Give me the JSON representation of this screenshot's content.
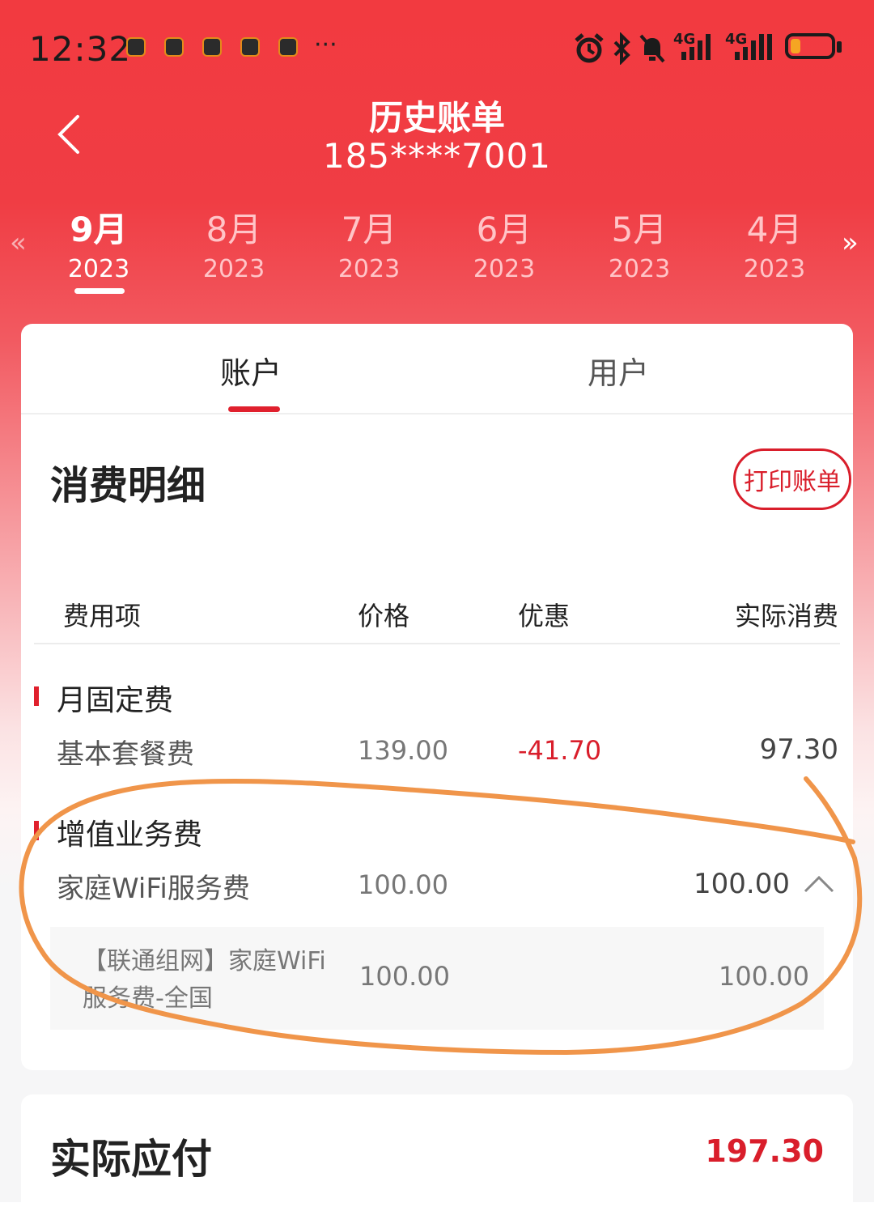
{
  "status_bar": {
    "time": "12:32",
    "more": "···",
    "network_1": "4G",
    "network_2": "4G"
  },
  "header": {
    "title": "历史账单",
    "phone": "185****7001"
  },
  "months": [
    {
      "month": "9月",
      "year": "2023",
      "active": true
    },
    {
      "month": "8月",
      "year": "2023"
    },
    {
      "month": "7月",
      "year": "2023"
    },
    {
      "month": "6月",
      "year": "2023"
    },
    {
      "month": "5月",
      "year": "2023"
    },
    {
      "month": "4月",
      "year": "2023"
    }
  ],
  "nav_arrows": {
    "prev": "«",
    "next": "»"
  },
  "tabs": {
    "account": "账户",
    "user": "用户"
  },
  "detail": {
    "title": "消费明细",
    "print_button": "打印账单",
    "columns": [
      "费用项",
      "价格",
      "优惠",
      "实际消费"
    ],
    "groups": [
      {
        "name": "月固定费",
        "items": [
          {
            "name": "基本套餐费",
            "price": "139.00",
            "discount": "-41.70",
            "actual": "97.30"
          }
        ]
      },
      {
        "name": "增值业务费",
        "items": [
          {
            "name": "家庭WiFi服务费",
            "price": "100.00",
            "discount": "",
            "actual": "100.00"
          }
        ],
        "sub_items": [
          {
            "name": "【联通组网】家庭WiFi服务费-全国",
            "price": "100.00",
            "actual": "100.00"
          }
        ]
      }
    ]
  },
  "total": {
    "label": "实际应付",
    "value": "197.30"
  },
  "colors": {
    "brand_red": "#e0202d",
    "annotation_orange": "#f0954a"
  }
}
